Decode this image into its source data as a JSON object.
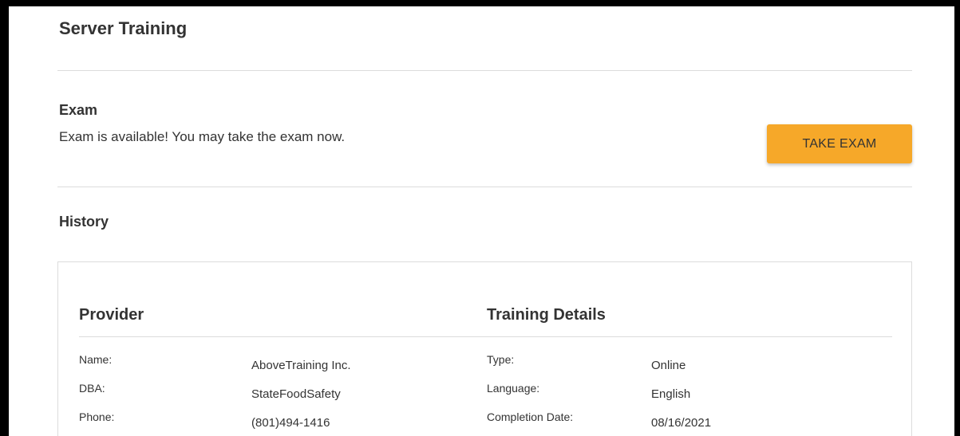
{
  "page": {
    "title": "Server Training"
  },
  "exam": {
    "heading": "Exam",
    "message": "Exam is available! You may take the exam now.",
    "button_label": "TAKE EXAM",
    "button_color": "#f6a829"
  },
  "history": {
    "heading": "History",
    "provider": {
      "heading": "Provider",
      "fields": [
        {
          "label": "Name:",
          "value": "AboveTraining Inc."
        },
        {
          "label": "DBA:",
          "value": "StateFoodSafety"
        },
        {
          "label": "Phone:",
          "value": "(801)494-1416"
        }
      ]
    },
    "training_details": {
      "heading": "Training Details",
      "fields": [
        {
          "label": "Type:",
          "value": "Online"
        },
        {
          "label": "Language:",
          "value": "English"
        },
        {
          "label": "Completion Date:",
          "value": "08/16/2021"
        }
      ]
    }
  }
}
